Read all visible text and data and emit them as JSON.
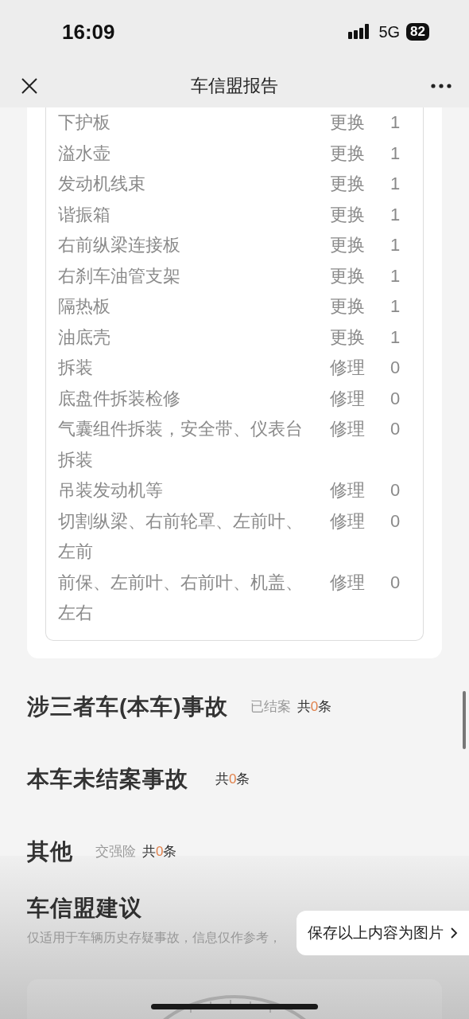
{
  "status_bar": {
    "time": "16:09",
    "network": "5G",
    "battery": "82"
  },
  "nav": {
    "title": "车信盟报告"
  },
  "parts": [
    {
      "name": "下护板",
      "action": "更换",
      "qty": "1"
    },
    {
      "name": "溢水壶",
      "action": "更换",
      "qty": "1"
    },
    {
      "name": "发动机线束",
      "action": "更换",
      "qty": "1"
    },
    {
      "name": "谐振箱",
      "action": "更换",
      "qty": "1"
    },
    {
      "name": "右前纵梁连接板",
      "action": "更换",
      "qty": "1"
    },
    {
      "name": "右刹车油管支架",
      "action": "更换",
      "qty": "1"
    },
    {
      "name": "隔热板",
      "action": "更换",
      "qty": "1"
    },
    {
      "name": "油底壳",
      "action": "更换",
      "qty": "1"
    },
    {
      "name": "拆装",
      "action": "修理",
      "qty": "0"
    },
    {
      "name": "底盘件拆装检修",
      "action": "修理",
      "qty": "0"
    },
    {
      "name": "气囊组件拆装，安全带、仪表台拆装",
      "action": "修理",
      "qty": "0"
    },
    {
      "name": "吊装发动机等",
      "action": "修理",
      "qty": "0"
    },
    {
      "name": "切割纵梁、右前轮罩、左前叶、左前",
      "action": "修理",
      "qty": "0"
    },
    {
      "name": "前保、左前叶、右前叶、机盖、左右",
      "action": "修理",
      "qty": "0"
    }
  ],
  "sections": [
    {
      "title": "涉三者车(本车)事故",
      "tag": "已结案",
      "count": {
        "before": "共",
        "value": "0",
        "after": "条"
      }
    },
    {
      "title": "本车未结案事故",
      "count": {
        "before": "共",
        "value": "0",
        "after": "条"
      }
    },
    {
      "title": "其他",
      "tag": "交强险",
      "count": {
        "before": "共",
        "value": "0",
        "after": "条"
      }
    }
  ],
  "advice": {
    "title": "车信盟建议",
    "note": "仅适用于车辆历史存疑事故，信息仅作参考，"
  },
  "save_button": "保存以上内容为图片"
}
